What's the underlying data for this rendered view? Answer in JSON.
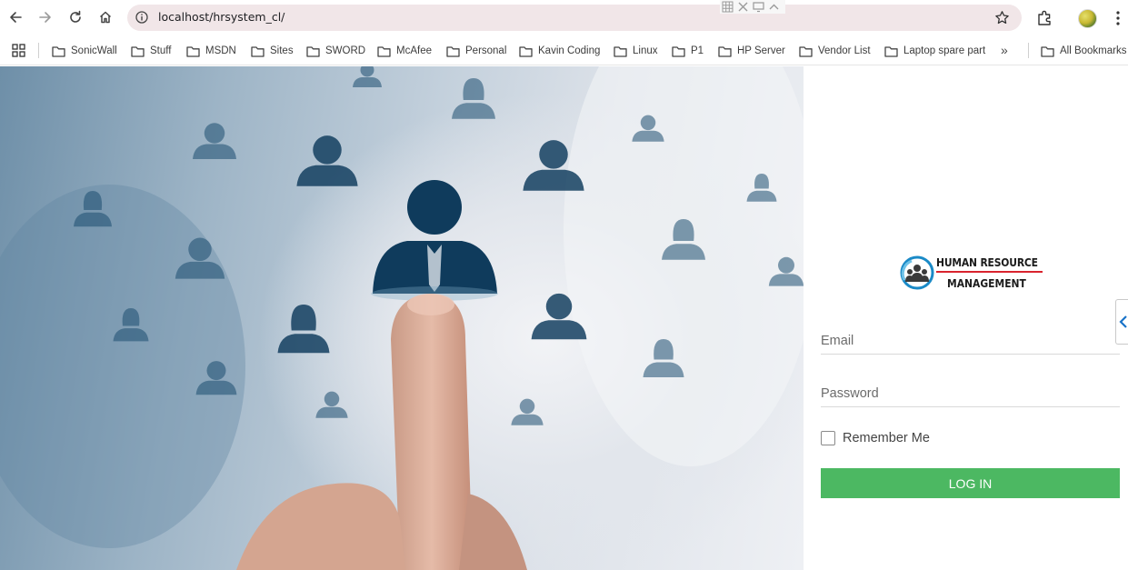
{
  "browser": {
    "url": "localhost/hrsystem_cl/",
    "icons": [
      "back-icon",
      "forward-icon",
      "reload-icon",
      "home-icon",
      "info-icon",
      "star-icon",
      "extensions-icon",
      "profile-avatar",
      "menu-icon"
    ]
  },
  "bookmarks": {
    "items": [
      "SonicWall",
      "Stuff",
      "MSDN",
      "Sites",
      "SWORD",
      "McAfee",
      "Personal",
      "Kavin Coding",
      "Linux",
      "P1",
      "HP Server",
      "Vendor List",
      "Laptop spare part"
    ],
    "more": "»",
    "all_label": "All Bookmarks"
  },
  "login": {
    "logo_line1": "HUMAN RESOURCE",
    "logo_line2": "MANAGEMENT",
    "email_placeholder": "Email",
    "password_placeholder": "Password",
    "remember_label": "Remember Me",
    "button_label": "LOG IN"
  },
  "colors": {
    "accent_green": "#4cb862",
    "logo_red": "#d9232e",
    "logo_blue": "#1a8ac7",
    "omnibox_bg": "#f1e6e8"
  }
}
